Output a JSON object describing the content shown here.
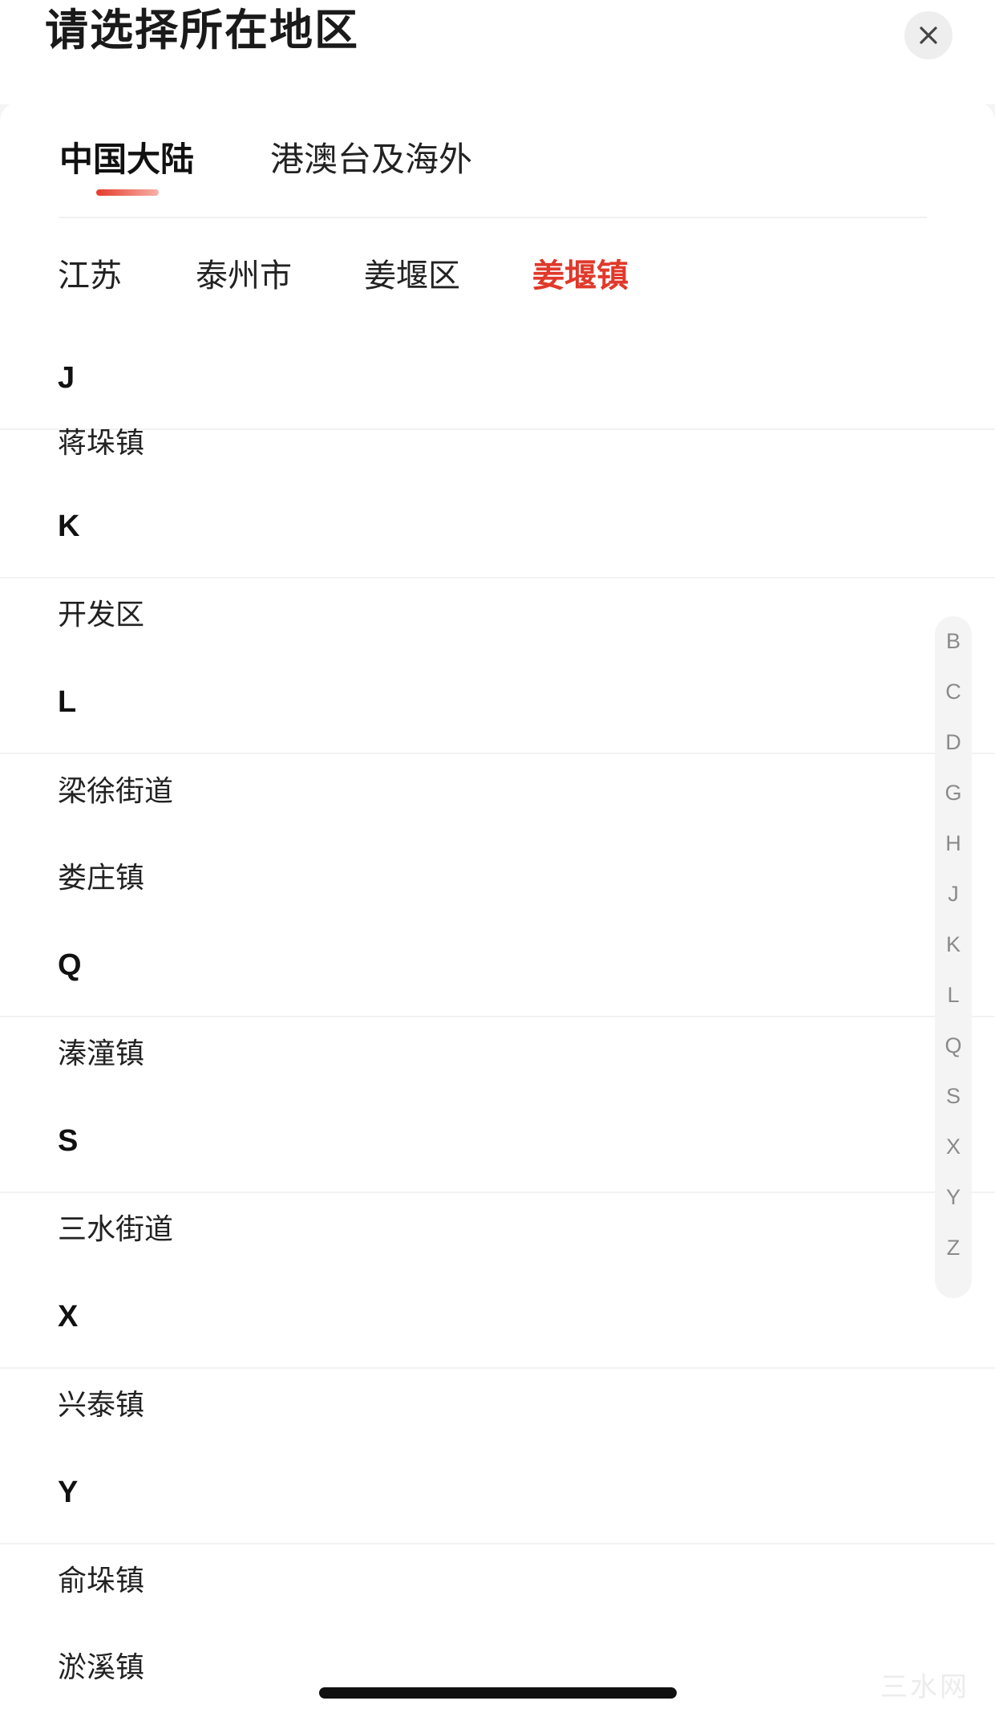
{
  "title": "请选择所在地区",
  "tabs": [
    {
      "label": "中国大陆",
      "active": true
    },
    {
      "label": "港澳台及海外",
      "active": false
    }
  ],
  "breadcrumb": [
    "江苏",
    "泰州市",
    "姜堰区",
    "姜堰镇"
  ],
  "groups": [
    {
      "letter": "J",
      "items": [
        "蒋垛镇"
      ]
    },
    {
      "letter": "K",
      "items": [
        "开发区"
      ]
    },
    {
      "letter": "L",
      "items": [
        "梁徐街道",
        "娄庄镇"
      ]
    },
    {
      "letter": "Q",
      "items": [
        "溱潼镇"
      ]
    },
    {
      "letter": "S",
      "items": [
        "三水街道"
      ]
    },
    {
      "letter": "X",
      "items": [
        "兴泰镇"
      ]
    },
    {
      "letter": "Y",
      "items": [
        "俞垛镇",
        "淤溪镇"
      ]
    }
  ],
  "index_letters": [
    "B",
    "C",
    "D",
    "G",
    "H",
    "J",
    "K",
    "L",
    "Q",
    "S",
    "X",
    "Y",
    "Z"
  ],
  "watermark": "三水网",
  "colors": {
    "accent": "#e0392b",
    "background": "#ffffff",
    "index_bar": "#f4f4f4"
  },
  "icons": {
    "close": "close-icon"
  }
}
